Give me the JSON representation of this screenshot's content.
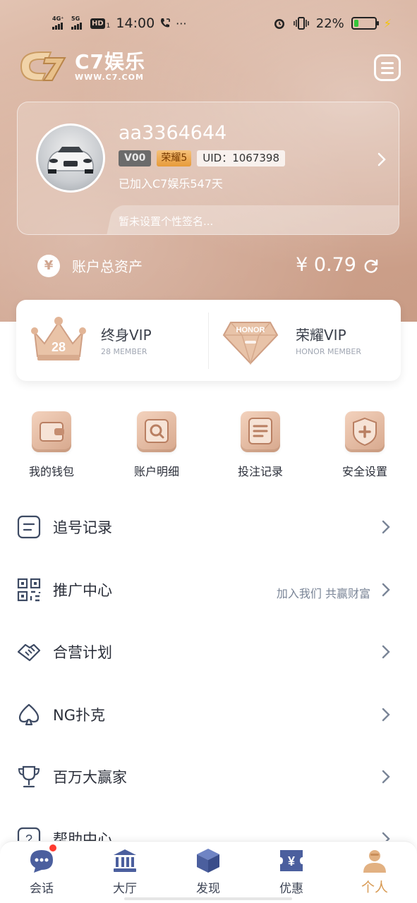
{
  "status_bar": {
    "sim1": "4G⁺",
    "sim2": "5G",
    "hd": "HD",
    "hd_sub": "1",
    "time": "14:00",
    "more": "···",
    "battery_pct": "22%",
    "battery_level": 0.22,
    "icons": [
      "call-icon",
      "alarm-icon",
      "vibrate-icon",
      "battery-icon",
      "charging-bolt-icon"
    ]
  },
  "header": {
    "logo_title": "C7娱乐",
    "logo_url": "WWW.C7.COM",
    "menu_icon": "menu-icon"
  },
  "profile": {
    "username": "aa3364644",
    "vip_badge": "V00",
    "honor_badge": "荣耀5",
    "uid": "UID：1067398",
    "joined": "已加入C7娱乐547天",
    "signature": "暂未设置个性签名..."
  },
  "assets": {
    "label": "账户总资产",
    "icon_glyph": "¥",
    "value": "¥ 0.79"
  },
  "vip": {
    "lifetime_title": "终身VIP",
    "lifetime_sub": "28 MEMBER",
    "crown_number": "28",
    "honor_title": "荣耀VIP",
    "honor_sub": "HONOR MEMBER",
    "diamond_text": "HONOR"
  },
  "quick_actions": [
    {
      "label": "我的钱包",
      "icon": "wallet-icon"
    },
    {
      "label": "账户明细",
      "icon": "search-icon"
    },
    {
      "label": "投注记录",
      "icon": "list-icon"
    },
    {
      "label": "安全设置",
      "icon": "shield-icon"
    }
  ],
  "menu_list": [
    {
      "label": "追号记录",
      "hint": "",
      "icon": "note-icon"
    },
    {
      "label": "推广中心",
      "hint": "加入我们 共赢财富",
      "icon": "qr-code-icon"
    },
    {
      "label": "合营计划",
      "hint": "",
      "icon": "handshake-icon"
    },
    {
      "label": "NG扑克",
      "hint": "",
      "icon": "spade-icon"
    },
    {
      "label": "百万大赢家",
      "hint": "",
      "icon": "trophy-icon"
    },
    {
      "label": "帮助中心",
      "hint": "",
      "icon": "help-icon"
    }
  ],
  "tabs": [
    {
      "label": "会话",
      "icon": "chat-icon",
      "badge": true
    },
    {
      "label": "大厅",
      "icon": "lobby-icon"
    },
    {
      "label": "发现",
      "icon": "cube-icon"
    },
    {
      "label": "优惠",
      "icon": "coupon-icon"
    },
    {
      "label": "个人",
      "icon": "person-icon",
      "active": true
    }
  ],
  "colors": {
    "accent_gold": "#d89b55",
    "hero_bg": "#d5ac97",
    "icon_line": "#3d4a63",
    "hint_text": "#7a8597"
  }
}
